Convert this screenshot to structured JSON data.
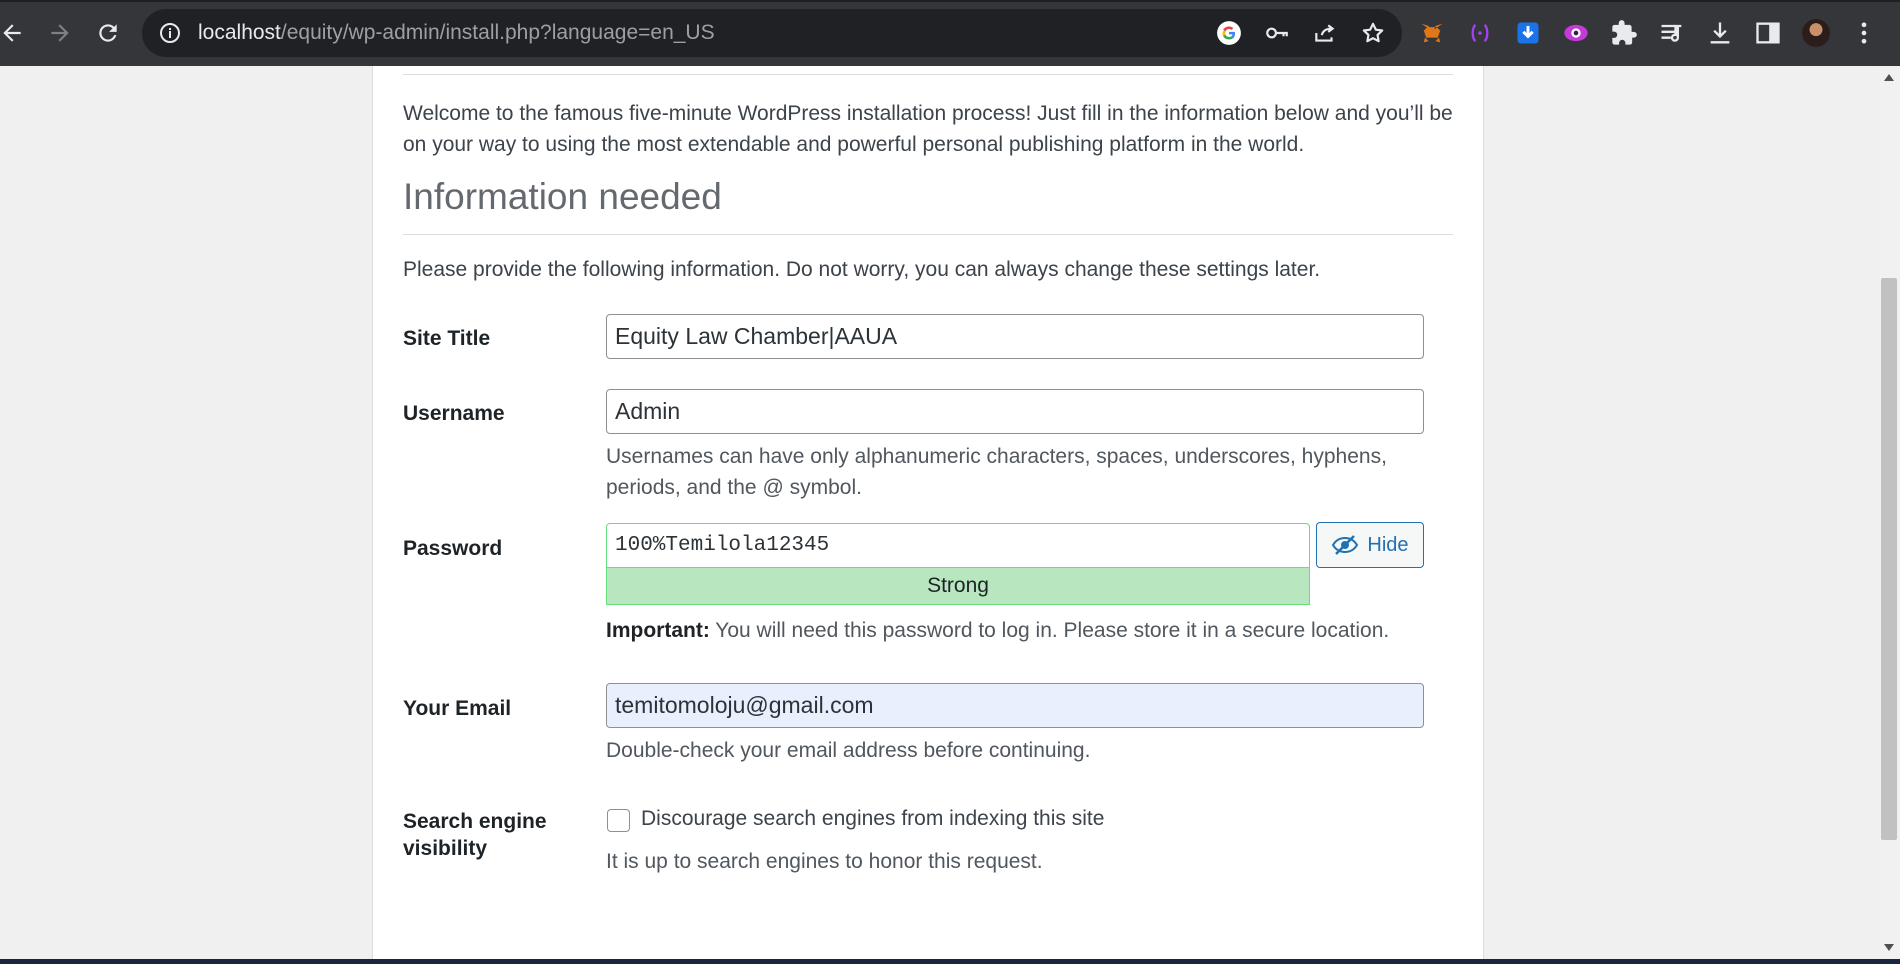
{
  "browser": {
    "url_host": "localhost",
    "url_path": "/equity/wp-admin/install.php?language=en_US"
  },
  "page": {
    "intro": "Welcome to the famous five-minute WordPress installation process! Just fill in the information below and you’ll be on your way to using the most extendable and powerful personal publishing platform in the world.",
    "heading": "Information needed",
    "provide": "Please provide the following information. Do not worry, you can always change these settings later.",
    "site_title": {
      "label": "Site Title",
      "value": "Equity Law Chamber|AAUA"
    },
    "username": {
      "label": "Username",
      "value": "Admin",
      "hint": "Usernames can have only alphanumeric characters, spaces, underscores, hyphens, periods, and the @ symbol."
    },
    "password": {
      "label": "Password",
      "value": "100%Temilola12345",
      "strength": "Strong",
      "hide_label": "Hide",
      "important_label": "Important:",
      "important_text": " You will need this password to log in. Please store it in a secure location."
    },
    "email": {
      "label": "Your Email",
      "value": "temitomoloju@gmail.com",
      "hint": "Double-check your email address before continuing."
    },
    "search_engine": {
      "label": "Search engine visibility",
      "checkbox_label": "Discourage search engines from indexing this site",
      "hint": "It is up to search engines to honor this request."
    }
  },
  "colors": {
    "toolbar": "#35363a",
    "omnibox": "#202124",
    "wp_blue": "#2271b1",
    "strength_bg": "#b8e6bf"
  }
}
